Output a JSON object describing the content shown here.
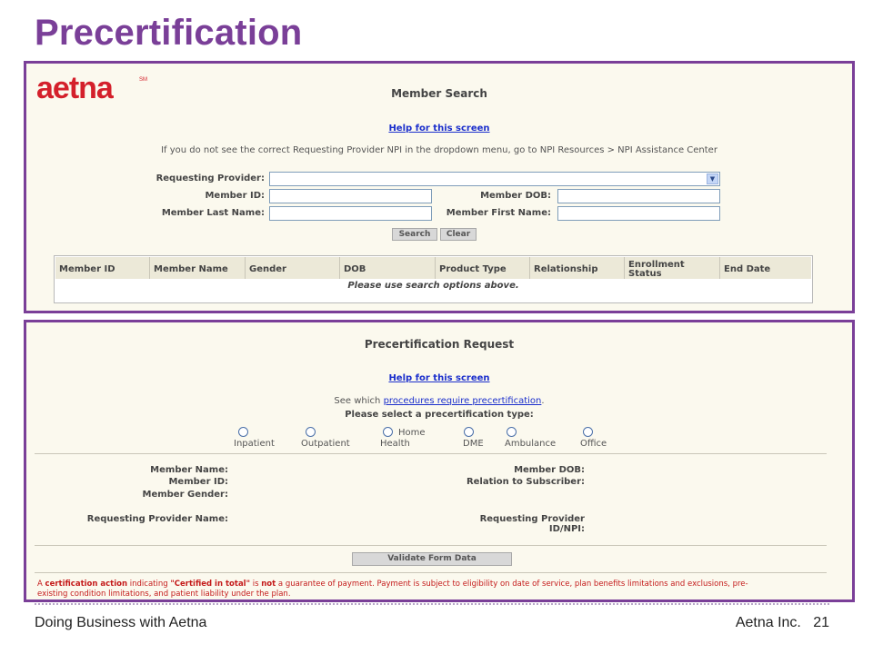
{
  "slide": {
    "title": "Precertification",
    "footer_left": "Doing Business with Aetna",
    "footer_company": "Aetna Inc.",
    "page_number": "21"
  },
  "logo": {
    "text": "aetna",
    "mark": "SM",
    "color": "#d4202b"
  },
  "member_search": {
    "heading": "Member Search",
    "help_link": "Help for this screen",
    "note": "If you do not see the correct Requesting Provider NPI in the dropdown menu, go to NPI Resources > NPI Assistance Center",
    "fields": {
      "requesting_provider": {
        "label": "Requesting Provider:",
        "value": ""
      },
      "member_id": {
        "label": "Member ID:",
        "value": ""
      },
      "member_dob": {
        "label": "Member DOB:",
        "value": ""
      },
      "member_last_name": {
        "label": "Member Last Name:",
        "value": ""
      },
      "member_first_name": {
        "label": "Member First Name:",
        "value": ""
      }
    },
    "buttons": {
      "search": "Search",
      "clear": "Clear"
    },
    "table": {
      "columns": [
        "Member ID",
        "Member Name",
        "Gender",
        "DOB",
        "Product Type",
        "Relationship",
        "Enrollment Status",
        "End Date"
      ],
      "empty_message": "Please use search options above."
    }
  },
  "precert_request": {
    "heading": "Precertification Request",
    "help_link": "Help for this screen",
    "see_which_prefix": "See which",
    "procedures_link": "procedures require precertification",
    "see_which_suffix": ".",
    "select_prompt": "Please select a precertification type:",
    "types": [
      {
        "label": "Inpatient",
        "label_top": ""
      },
      {
        "label": "Outpatient",
        "label_top": ""
      },
      {
        "label": "Health",
        "label_top": "Home"
      },
      {
        "label": "DME",
        "label_top": ""
      },
      {
        "label": "Ambulance",
        "label_top": ""
      },
      {
        "label": "Office",
        "label_top": ""
      }
    ],
    "info_left": {
      "member_name": "Member Name:",
      "member_id": "Member ID:",
      "member_gender": "Member Gender:",
      "requesting_provider_name": "Requesting Provider Name:"
    },
    "info_right": {
      "member_dob": "Member DOB:",
      "relation": "Relation to Subscriber:",
      "requesting_provider_line1": "Requesting Provider",
      "requesting_provider_line2": "ID/NPI:"
    },
    "validate_button": "Validate Form Data",
    "disclaimer": {
      "p1": "A ",
      "b1": "certification action",
      "p2": " indicating ",
      "b2": "\"Certified in total\"",
      "p3": " is ",
      "b3": "not",
      "p4": " a guarantee of payment. Payment is subject to eligibility on date of service, plan benefits limitations and exclusions, pre-existing condition limitations, and patient liability under the plan."
    }
  }
}
